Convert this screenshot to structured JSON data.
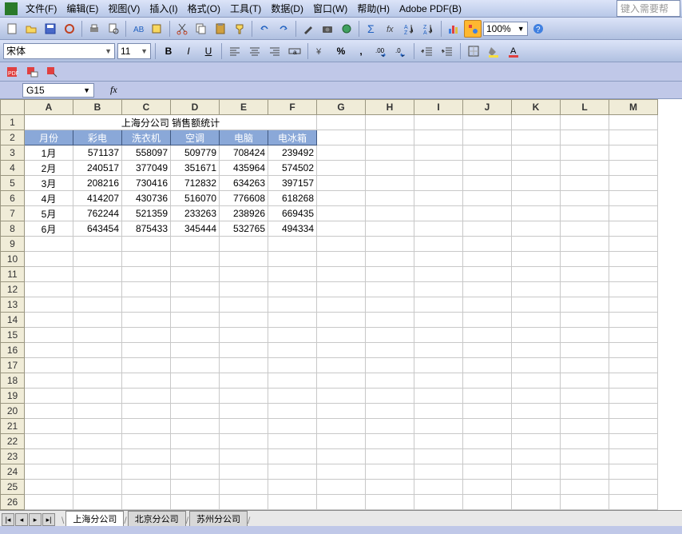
{
  "menu": {
    "file": "文件(F)",
    "edit": "编辑(E)",
    "view": "视图(V)",
    "insert": "插入(I)",
    "format": "格式(O)",
    "tools": "工具(T)",
    "data": "数据(D)",
    "window": "窗口(W)",
    "help": "帮助(H)",
    "adobe": "Adobe PDF(B)"
  },
  "help_placeholder": "键入需要帮",
  "font": {
    "name": "宋体",
    "size": "11"
  },
  "zoom": "100%",
  "name_box": "G15",
  "fx": "fx",
  "columns": [
    "A",
    "B",
    "C",
    "D",
    "E",
    "F",
    "G",
    "H",
    "I",
    "J",
    "K",
    "L",
    "M"
  ],
  "row_count": 26,
  "title": "上海分公司  销售额统计",
  "headers": [
    "月份",
    "彩电",
    "洗衣机",
    "空调",
    "电脑",
    "电冰箱"
  ],
  "rows": [
    [
      "1月",
      "571137",
      "558097",
      "509779",
      "708424",
      "239492"
    ],
    [
      "2月",
      "240517",
      "377049",
      "351671",
      "435964",
      "574502"
    ],
    [
      "3月",
      "208216",
      "730416",
      "712832",
      "634263",
      "397157"
    ],
    [
      "4月",
      "414207",
      "430736",
      "516070",
      "776608",
      "618268"
    ],
    [
      "5月",
      "762244",
      "521359",
      "233263",
      "238926",
      "669435"
    ],
    [
      "6月",
      "643454",
      "875433",
      "345444",
      "532765",
      "494334"
    ]
  ],
  "tabs": {
    "t1": "上海分公司",
    "t2": "北京分公司",
    "t3": "苏州分公司"
  },
  "chart_data": {
    "type": "table",
    "title": "上海分公司  销售额统计",
    "columns": [
      "月份",
      "彩电",
      "洗衣机",
      "空调",
      "电脑",
      "电冰箱"
    ],
    "data": [
      {
        "月份": "1月",
        "彩电": 571137,
        "洗衣机": 558097,
        "空调": 509779,
        "电脑": 708424,
        "电冰箱": 239492
      },
      {
        "月份": "2月",
        "彩电": 240517,
        "洗衣机": 377049,
        "空调": 351671,
        "电脑": 435964,
        "电冰箱": 574502
      },
      {
        "月份": "3月",
        "彩电": 208216,
        "洗衣机": 730416,
        "空调": 712832,
        "电脑": 634263,
        "电冰箱": 397157
      },
      {
        "月份": "4月",
        "彩电": 414207,
        "洗衣机": 430736,
        "空调": 516070,
        "电脑": 776608,
        "电冰箱": 618268
      },
      {
        "月份": "5月",
        "彩电": 762244,
        "洗衣机": 521359,
        "空调": 233263,
        "电脑": 238926,
        "电冰箱": 669435
      },
      {
        "月份": "6月",
        "彩电": 643454,
        "洗衣机": 875433,
        "空调": 345444,
        "电脑": 532765,
        "电冰箱": 494334
      }
    ]
  }
}
